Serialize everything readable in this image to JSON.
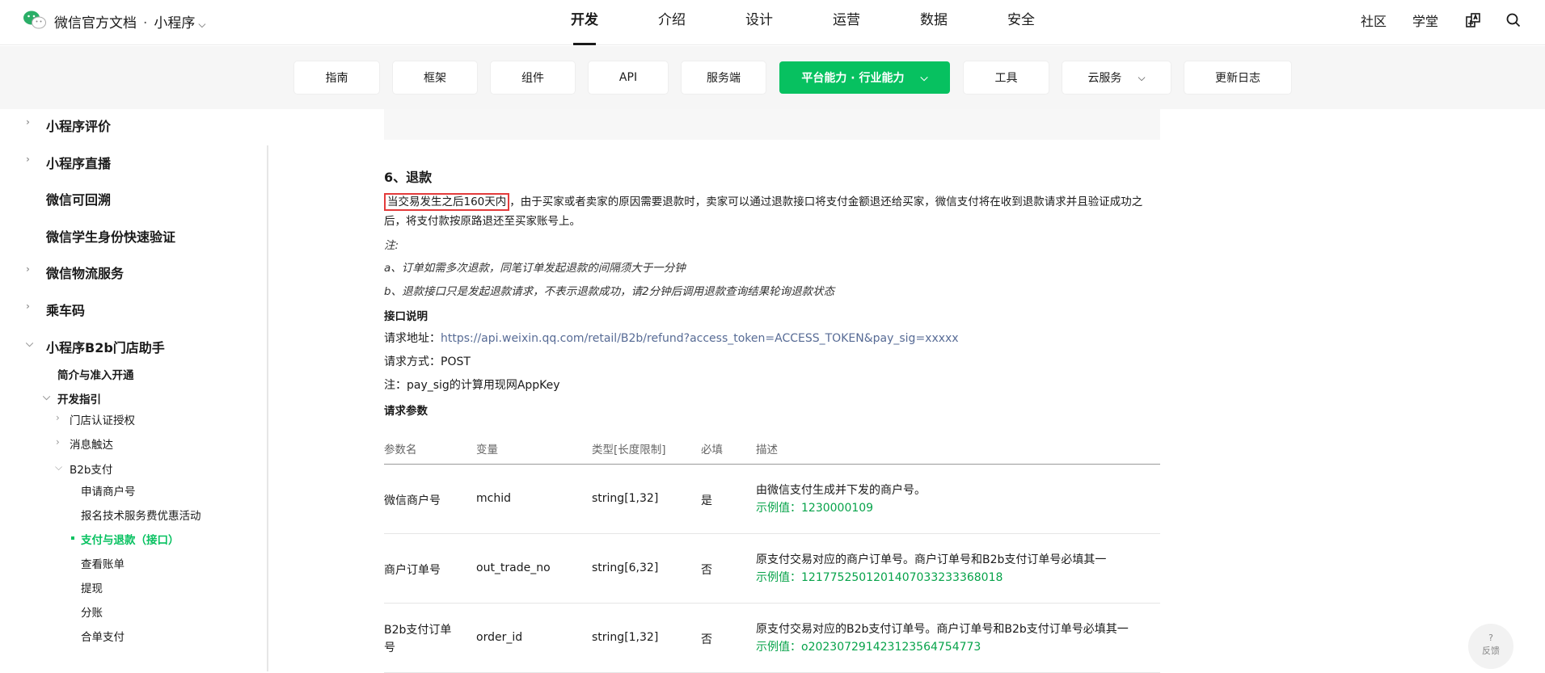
{
  "header": {
    "brand": "微信官方文档",
    "section": "小程序",
    "nav": [
      "开发",
      "介绍",
      "设计",
      "运营",
      "数据",
      "安全"
    ],
    "right_links": [
      "社区",
      "学堂"
    ]
  },
  "subnav": {
    "tabs": [
      "指南",
      "框架",
      "组件",
      "API",
      "服务端",
      "平台能力 · 行业能力",
      "工具",
      "云服务",
      "更新日志"
    ]
  },
  "sidebar": {
    "items": [
      "小程序评价",
      "小程序直播",
      "微信可回溯",
      "微信学生身份快速验证",
      "微信物流服务",
      "乘车码",
      "小程序B2b门店助手",
      "简介与准入开通",
      "开发指引",
      "门店认证授权",
      "消息触达",
      "B2b支付",
      "申请商户号",
      "报名技术服务费优惠活动",
      "支付与退款（接口）",
      "查看账单",
      "提现",
      "分账",
      "合单支付"
    ]
  },
  "article": {
    "heading": "6、退款",
    "highlight": "当交易发生之后160天内",
    "para_rest": "，由于买家或者卖家的原因需要退款时，卖家可以通过退款接口将支付金额退还给买家，微信支付将在收到退款请求并且验证成功之后，将支付款按原路退还至买家账号上。",
    "note_title": "注:",
    "note_a": "a、订单如需多次退款，同笔订单发起退款的间隔须大于一分钟",
    "note_b": "b、退款接口只是发起退款请求，不表示退款成功，请2分钟后调用退款查询结果轮询退款状态",
    "api_title": "接口说明",
    "url_label": "请求地址：",
    "url": "https://api.weixin.qq.com/retail/B2b/refund?access_token=ACCESS_TOKEN&pay_sig=xxxxx",
    "method_label": "请求方式：",
    "method": "POST",
    "sig_note": "注：pay_sig的计算用现网AppKey",
    "params_title": "请求参数"
  },
  "table": {
    "headers": [
      "参数名",
      "变量",
      "类型[长度限制]",
      "必填",
      "描述"
    ],
    "rows": [
      {
        "name": "微信商户号",
        "var": "mchid",
        "type": "string[1,32]",
        "req": "是",
        "desc": "由微信支付生成并下发的商户号。",
        "example": "示例值：1230000109"
      },
      {
        "name": "商户订单号",
        "var": "out_trade_no",
        "type": "string[6,32]",
        "req": "否",
        "desc": "原支付交易对应的商户订单号。商户订单号和B2b支付订单号必填其一",
        "example": "示例值：1217752501201407033233368018"
      },
      {
        "name": "B2b支付订单号",
        "var": "order_id",
        "type": "string[1,32]",
        "req": "否",
        "desc": "原支付交易对应的B2b支付订单号。商户订单号和B2b支付订单号必填其一",
        "example": "示例值：o20230729142312356475477​3"
      }
    ]
  },
  "feedback": {
    "icon": "?",
    "label": "反馈"
  }
}
